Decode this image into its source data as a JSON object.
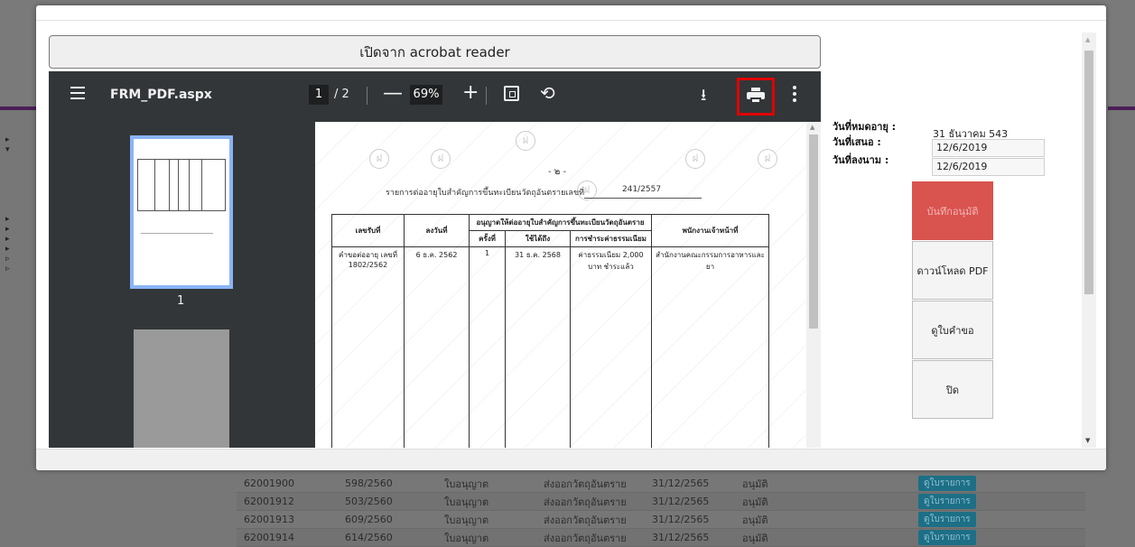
{
  "modal": {
    "open_button_label": "เปิดจาก acrobat reader"
  },
  "viewer": {
    "file_name": "FRM_PDF.aspx",
    "current_page": "1",
    "page_total": "/ 2",
    "zoom": "69%",
    "minus_icon": "—",
    "plus_icon": "+",
    "rotate_icon": "⟲",
    "download_icon": "⭳",
    "thumbnail_page_label": "1",
    "highlight_color": "#e00000"
  },
  "document": {
    "page_marker": "- ๒ -",
    "heading": "รายการต่ออายุใบสำคัญการขึ้นทะเบียนวัตถุอันตรายเลขที่",
    "reg_no": "241/2557",
    "table": {
      "headers": {
        "receipt_no": "เลขรับที่",
        "date": "ลงวันที่",
        "group": "อนุญาตให้ต่ออายุใบสำคัญการขึ้นทะเบียนวัตถุอันตราย",
        "officer": "พนักงานเจ้าหน้าที่",
        "count": "ครั้งที่",
        "valid_until": "ใช้ได้ถึง",
        "fee": "การชำระค่าธรรมเนียม"
      },
      "row": {
        "receipt_no": "คำขอต่ออายุ เลขที่ 1802/2562",
        "date": "6 ธ.ค. 2562",
        "count": "1",
        "valid_until": "31 ธ.ค. 2568",
        "fee": "ค่าธรรมเนียม 2,000 บาท ชำระแล้ว",
        "officer": "สำนักงานคณะกรรมการอาหารและยา"
      }
    }
  },
  "info": {
    "expiry_label": "วันที่หมดอายุ :",
    "expiry_value": "31 ธันวาคม 543",
    "submit_label": "วันที่เสนอ :",
    "submit_value": "12/6/2019",
    "sign_label": "วันที่ลงนาม :",
    "sign_value": "12/6/2019"
  },
  "actions": {
    "approve": "บันทึกอนุมัติ",
    "download_pdf": "ดาวน์โหลด PDF",
    "view_request": "ดูใบคำขอ",
    "close": "ปิด",
    "approve_color": "#d9534f"
  },
  "background_table": {
    "rows": [
      {
        "id": "62001900",
        "ref": "598/2560",
        "type": "ใบอนุญาต",
        "desc": "ส่งออกวัตถุอันตราย",
        "date": "31/12/2565",
        "status": "อนุมัติ",
        "action": "ดูใบรายการ"
      },
      {
        "id": "62001912",
        "ref": "503/2560",
        "type": "ใบอนุญาต",
        "desc": "ส่งออกวัตถุอันตราย",
        "date": "31/12/2565",
        "status": "อนุมัติ",
        "action": "ดูใบรายการ"
      },
      {
        "id": "62001913",
        "ref": "609/2560",
        "type": "ใบอนุญาต",
        "desc": "ส่งออกวัตถุอันตราย",
        "date": "31/12/2565",
        "status": "อนุมัติ",
        "action": "ดูใบรายการ"
      },
      {
        "id": "62001914",
        "ref": "614/2560",
        "type": "ใบอนุญาต",
        "desc": "ส่งออกวัตถุอันตราย",
        "date": "31/12/2565",
        "status": "อนุมัติ",
        "action": "ดูใบรายการ"
      }
    ]
  }
}
